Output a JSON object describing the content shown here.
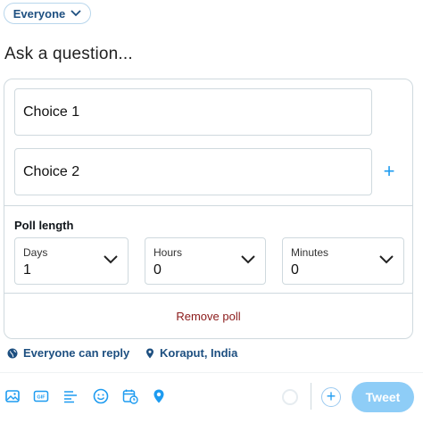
{
  "audience": {
    "label": "Everyone"
  },
  "compose": {
    "placeholder": "Ask a question..."
  },
  "poll": {
    "choices": [
      {
        "placeholder": "Choice 1"
      },
      {
        "placeholder": "Choice 2"
      }
    ],
    "add_choice_icon": "plus-icon",
    "length_label": "Poll length",
    "days": {
      "label": "Days",
      "value": "1"
    },
    "hours": {
      "label": "Hours",
      "value": "0"
    },
    "minutes": {
      "label": "Minutes",
      "value": "0"
    },
    "remove_label": "Remove poll"
  },
  "reply_settings": {
    "label": "Everyone can reply",
    "icon": "globe-icon"
  },
  "location": {
    "label": "Koraput, India",
    "icon": "location-pin-icon"
  },
  "toolbar": {
    "icons": [
      "image-icon",
      "gif-icon",
      "poll-icon",
      "emoji-icon",
      "schedule-icon",
      "location-icon"
    ],
    "tweet_label": "Tweet"
  },
  "colors": {
    "accent": "#1d9bf0",
    "tweet_button_disabled": "#8ecdf7",
    "remove": "#8b1a1a",
    "link": "#1d4f80"
  }
}
